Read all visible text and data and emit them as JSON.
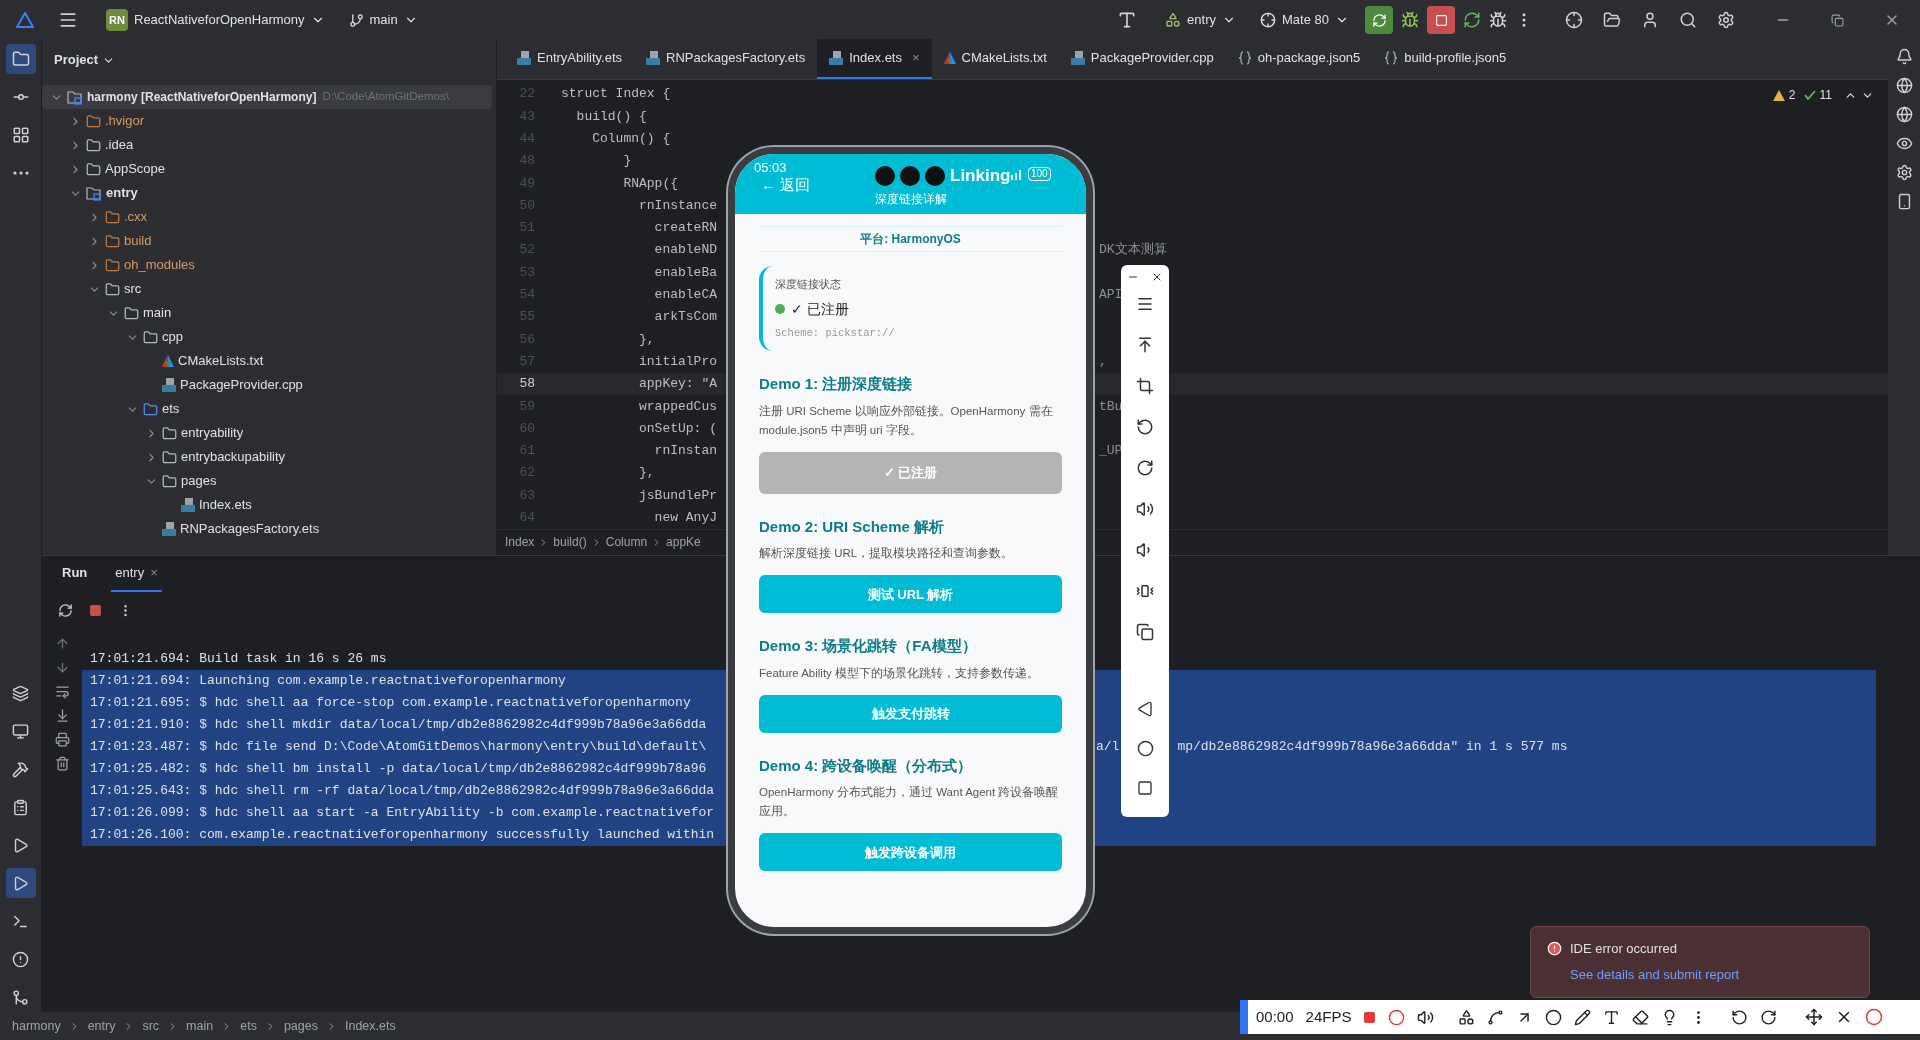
{
  "title_bar": {
    "project_badge": "RN",
    "project": "ReactNativeforOpenHarmony",
    "branch": "main",
    "run_config": "entry",
    "device": "Mate 80"
  },
  "project_panel": {
    "title": "Project",
    "tree": [
      {
        "label": "harmony [ReactNativeforOpenHarmony]",
        "path": "D:\\Code\\AtomGitDemos\\",
        "kind": "module",
        "expanded": true,
        "selected": true,
        "children": [
          {
            "label": ".hvigor",
            "kind": "excluded",
            "expanded": false,
            "selected": false
          },
          {
            "label": ".idea",
            "kind": "folder",
            "expanded": false,
            "selected": false
          },
          {
            "label": "AppScope",
            "kind": "folder",
            "expanded": false,
            "selected": false
          },
          {
            "label": "entry",
            "kind": "module",
            "expanded": true,
            "selected": false,
            "children": [
              {
                "label": ".cxx",
                "kind": "excluded",
                "expanded": false,
                "selected": false
              },
              {
                "label": "build",
                "kind": "excluded",
                "expanded": false,
                "selected": false
              },
              {
                "label": "oh_modules",
                "kind": "excluded",
                "expanded": false,
                "selected": false
              },
              {
                "label": "src",
                "kind": "folder",
                "expanded": true,
                "selected": false,
                "children": [
                  {
                    "label": "main",
                    "kind": "folder",
                    "expanded": true,
                    "selected": false,
                    "children": [
                      {
                        "label": "cpp",
                        "kind": "folder",
                        "expanded": true,
                        "selected": false,
                        "children": [
                          {
                            "label": "CMakeLists.txt",
                            "kind": "cmake",
                            "selected": false
                          },
                          {
                            "label": "PackageProvider.cpp",
                            "kind": "cpp",
                            "selected": false
                          }
                        ]
                      },
                      {
                        "label": "ets",
                        "kind": "source",
                        "expanded": true,
                        "selected": false,
                        "children": [
                          {
                            "label": "entryability",
                            "kind": "folder",
                            "expanded": false,
                            "selected": false
                          },
                          {
                            "label": "entrybackupability",
                            "kind": "folder",
                            "expanded": false,
                            "selected": false
                          },
                          {
                            "label": "pages",
                            "kind": "folder",
                            "expanded": true,
                            "selected": false,
                            "children": [
                              {
                                "label": "Index.ets",
                                "kind": "ets",
                                "selected": false
                              }
                            ]
                          },
                          {
                            "label": "RNPackagesFactory.ets",
                            "kind": "ets",
                            "selected": false
                          }
                        ]
                      }
                    ]
                  }
                ]
              }
            ]
          }
        ]
      }
    ]
  },
  "editor": {
    "tabs": [
      {
        "label": "EntryAbility.ets",
        "kind": "ets",
        "selected": false
      },
      {
        "label": "RNPackagesFactory.ets",
        "kind": "ets",
        "selected": false
      },
      {
        "label": "Index.ets",
        "kind": "ets",
        "selected": true,
        "close": "×"
      },
      {
        "label": "CMakeLists.txt",
        "kind": "cmake",
        "selected": false
      },
      {
        "label": "PackageProvider.cpp",
        "kind": "cpp",
        "selected": false
      },
      {
        "label": "oh-package.json5",
        "kind": "json",
        "selected": false
      },
      {
        "label": "build-profile.json5",
        "kind": "json",
        "selected": false
      }
    ],
    "warnings": "2",
    "checks": "11",
    "lines": [
      {
        "number": "22",
        "text": "struct Index {",
        "current": false
      },
      {
        "number": "43",
        "text": "  build() {",
        "current": false
      },
      {
        "number": "44",
        "text": "    Column() {",
        "current": false
      },
      {
        "number": "48",
        "text": "        }",
        "current": false
      },
      {
        "number": "49",
        "text": "        RNApp({",
        "current": false
      },
      {
        "number": "50",
        "text": "          rnInstance",
        "current": false
      },
      {
        "number": "51",
        "text": "            createRN",
        "current": false
      },
      {
        "number": "52",
        "text": "            enableND",
        "tail": "DK文本测算",
        "current": false
      },
      {
        "number": "53",
        "text": "            enableBa",
        "current": false
      },
      {
        "number": "54",
        "text": "            enableCA",
        "tail": "API",
        "current": false
      },
      {
        "number": "55",
        "text": "            arkTsCom",
        "current": false
      },
      {
        "number": "56",
        "text": "          },",
        "current": false
      },
      {
        "number": "57",
        "text": "          initialPro",
        "tail": ",",
        "current": false
      },
      {
        "number": "58",
        "text": "          appKey: \"A",
        "current": true
      },
      {
        "number": "59",
        "text": "          wrappedCus",
        "tail": "tBu",
        "current": false
      },
      {
        "number": "60",
        "text": "          onSetUp: (",
        "current": false
      },
      {
        "number": "61",
        "text": "            rnInstan",
        "tail": "_UP",
        "current": false
      },
      {
        "number": "62",
        "text": "          },",
        "current": false
      },
      {
        "number": "63",
        "text": "          jsBundlePr",
        "current": false
      },
      {
        "number": "64",
        "text": "            new AnyJ",
        "current": false
      }
    ],
    "breadcrumb": [
      "Index",
      "build()",
      "Column",
      "appKe"
    ]
  },
  "run_panel": {
    "tabs": [
      {
        "label": "Run",
        "selected": false
      },
      {
        "label": "entry",
        "selected": true,
        "close": "×"
      }
    ],
    "console": [
      {
        "text": "17:01:21.694: Build task in 16 s 26 ms",
        "selected": false
      },
      {
        "text": "17:01:21.694: Launching com.example.reactnativeforopenharmony",
        "selected": true
      },
      {
        "text": "17:01:21.695: $ hdc shell aa force-stop com.example.reactnativeforopenharmony",
        "selected": true
      },
      {
        "text": "17:01:21.910: $ hdc shell mkdir data/local/tmp/db2e8862982c4df999b78a96e3a66dda",
        "selected": true
      },
      {
        "text": "17:01:23.487: $ hdc file send D:\\Code\\AtomGitDemos\\harmony\\entry\\build\\default\\",
        "tails": [
          "a/l",
          "mp/db2e8862982c4df999b78a96e3a66dda\" in 1 s 577 ms"
        ],
        "selected": true
      },
      {
        "text": "17:01:25.482: $ hdc shell bm install -p data/local/tmp/db2e8862982c4df999b78a96",
        "selected": true
      },
      {
        "text": "17:01:25.643: $ hdc shell rm -rf data/local/tmp/db2e8862982c4df999b78a96e3a66dda",
        "selected": true
      },
      {
        "text": "17:01:26.099: $ hdc shell aa start -a EntryAbility -b com.example.reactnativefor",
        "selected": true
      },
      {
        "text": "17:01:26.100: com.example.reactnativeforopenharmony successfully launched within",
        "selected": true
      }
    ]
  },
  "status_bar": {
    "path": [
      "harmony",
      "entry",
      "src",
      "main",
      "ets",
      "pages",
      "Index.ets"
    ]
  },
  "phone": {
    "time": "05:03",
    "back": "← 返回",
    "title": "Linking",
    "battery": "100",
    "subtitle": "深度链接详解",
    "platform": "平台: HarmonyOS",
    "status_card": {
      "label": "深度链接状态",
      "status": "✓ 已注册",
      "color": "#4caf50",
      "scheme": "Scheme: pickstar://"
    },
    "demos": [
      {
        "title": "Demo 1: 注册深度链接",
        "description": "注册 URI Scheme 以响应外部链接。OpenHarmony 需在 module.json5 中声明 uri 字段。",
        "button": "✓ 已注册",
        "kind": "disabled"
      },
      {
        "title": "Demo 2: URI Scheme 解析",
        "description": "解析深度链接 URL，提取模块路径和查询参数。",
        "button": "测试 URL 解析",
        "kind": "primary"
      },
      {
        "title": "Demo 3: 场景化跳转（FA模型）",
        "description": "Feature Ability 模型下的场景化跳转，支持参数传递。",
        "button": "触发支付跳转",
        "kind": "primary"
      },
      {
        "title": "Demo 4: 跨设备唤醒（分布式）",
        "description": "OpenHarmony 分布式能力，通过 Want Agent 跨设备唤醒应用。",
        "button": "触发跨设备调用",
        "kind": "primary"
      }
    ]
  },
  "notification": {
    "title": "IDE error occurred",
    "link": "See details and submit report"
  },
  "recorder": {
    "time": "00:00",
    "fps": "24FPS"
  }
}
